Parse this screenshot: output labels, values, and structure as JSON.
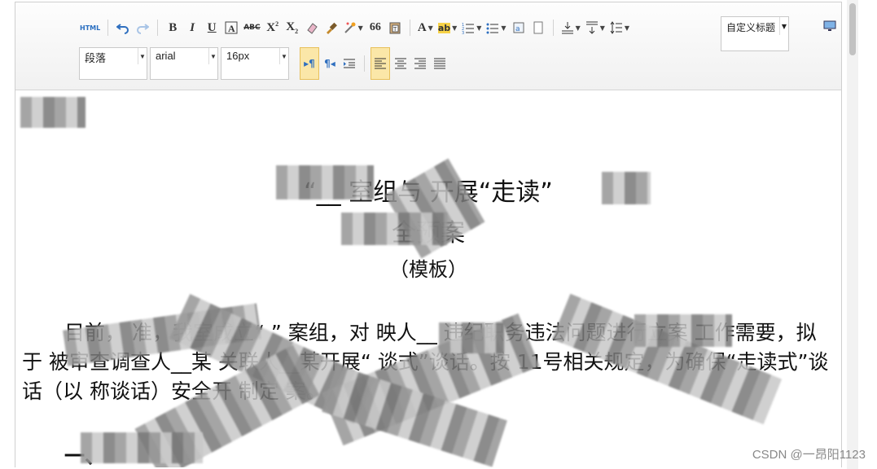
{
  "toolbar": {
    "html_label": "HTML",
    "bold": "B",
    "italic": "I",
    "underline": "U",
    "strikethrough": "ABC",
    "quote": "66",
    "font_color": "A",
    "highlight": "ab",
    "custom_title": "自定义标题",
    "paragraph": "段落",
    "font_family": "arial",
    "font_size": "16px"
  },
  "document": {
    "title_line1": "“__ 室组与 开展“走读”",
    "title_line2": "全预案",
    "subtitle": "（模板）",
    "body": "目前， 准，我室成立“ ” 案组，对 映人__ 违纪职务违法问题进行立案 工作需要，拟于 被审查调查人__某 关联人__某开展“ 谈式”谈话。按 11号相关规定，为确保“走读式”谈话（以 称谈话）安全开 制定 案。",
    "heading": "一、"
  },
  "watermark": "CSDN @一昂阳1123"
}
